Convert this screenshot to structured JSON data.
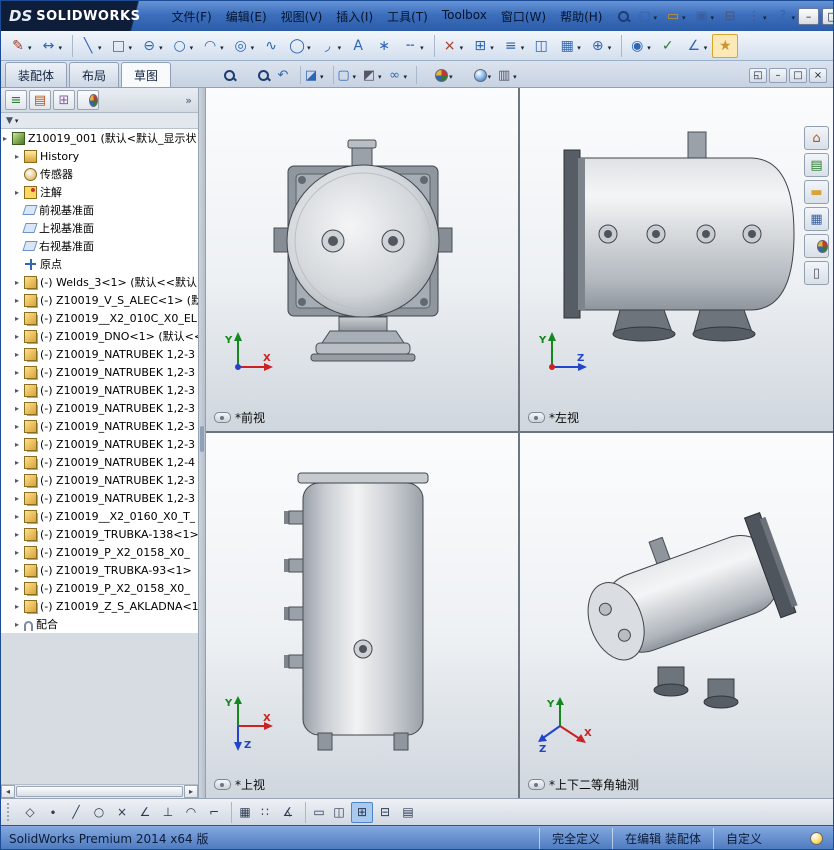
{
  "window": {
    "logo_prefix": "DS",
    "logo_text": "SOLIDWORKS",
    "min": "–",
    "max": "□",
    "close": "×"
  },
  "menu": {
    "items": [
      "文件(F)",
      "编辑(E)",
      "视图(V)",
      "插入(I)",
      "工具(T)",
      "Toolbox",
      "窗口(W)",
      "帮助(H)"
    ]
  },
  "quickbar": {
    "icons": [
      {
        "name": "new-document-button",
        "glyph": "▢",
        "color": "#3a5f9e",
        "dd": "dd"
      },
      {
        "name": "open-button",
        "glyph": "▭",
        "color": "#c9952c",
        "dd": "dd"
      },
      {
        "name": "save-button",
        "glyph": "▣",
        "color": "#3a5f9e",
        "dd": "dd"
      },
      {
        "name": "print-button",
        "glyph": "⊟",
        "color": "#556",
        "dd": ""
      },
      {
        "name": "options-button",
        "glyph": "⋮",
        "color": "#556",
        "dd": "dd"
      },
      {
        "name": "help-button",
        "glyph": "?",
        "color": "#2f66b3",
        "dd": "dd"
      }
    ]
  },
  "sketchbar": {
    "icons": [
      {
        "name": "sketch-tool-button",
        "glyph": "✎",
        "color": "#a33a2a",
        "dd": "dd",
        "cls": ""
      },
      {
        "name": "smart-dimension-button",
        "glyph": "↔",
        "color": "#2f66b3",
        "dd": "dd",
        "cls": ""
      },
      {
        "name": "line-tool-button",
        "glyph": "╲",
        "color": "#2f66b3",
        "dd": "dd",
        "cls": "sep"
      },
      {
        "name": "rectangle-tool-button",
        "glyph": "□",
        "color": "#2f66b3",
        "dd": "dd",
        "cls": ""
      },
      {
        "name": "slot-tool-button",
        "glyph": "⊖",
        "color": "#2f66b3",
        "dd": "dd",
        "cls": ""
      },
      {
        "name": "circle-tool-button",
        "glyph": "○",
        "color": "#2f66b3",
        "dd": "dd",
        "cls": ""
      },
      {
        "name": "arc-tool-button",
        "glyph": "◠",
        "color": "#2f66b3",
        "dd": "dd",
        "cls": ""
      },
      {
        "name": "perimeter-circle-button",
        "glyph": "◎",
        "color": "#2f66b3",
        "dd": "dd",
        "cls": ""
      },
      {
        "name": "spline-tool-button",
        "glyph": "∿",
        "color": "#2f66b3",
        "dd": "",
        "cls": ""
      },
      {
        "name": "ellipse-tool-button",
        "glyph": "◯",
        "color": "#2f66b3",
        "dd": "dd",
        "cls": ""
      },
      {
        "name": "fillet-tool-button",
        "glyph": "◞",
        "color": "#2f66b3",
        "dd": "dd",
        "cls": ""
      },
      {
        "name": "text-tool-button",
        "glyph": "A",
        "color": "#2f66b3",
        "dd": "",
        "cls": ""
      },
      {
        "name": "point-tool-button",
        "glyph": "∗",
        "color": "#2f66b3",
        "dd": "",
        "cls": ""
      },
      {
        "name": "centerline-tool-button",
        "glyph": "╌",
        "color": "#2f66b3",
        "dd": "dd",
        "cls": ""
      },
      {
        "name": "trim-entities-button",
        "glyph": "×",
        "color": "#a33a2a",
        "dd": "dd",
        "cls": "sep"
      },
      {
        "name": "convert-entities-button",
        "glyph": "⊞",
        "color": "#2f66b3",
        "dd": "dd",
        "cls": ""
      },
      {
        "name": "offset-entities-button",
        "glyph": "≡",
        "color": "#2f66b3",
        "dd": "dd",
        "cls": ""
      },
      {
        "name": "mirror-entities-button",
        "glyph": "◫",
        "color": "#2f66b3",
        "dd": "",
        "cls": ""
      },
      {
        "name": "linear-pattern-button",
        "glyph": "▦",
        "color": "#2f66b3",
        "dd": "dd",
        "cls": ""
      },
      {
        "name": "move-entities-button",
        "glyph": "⊕",
        "color": "#2f66b3",
        "dd": "dd",
        "cls": ""
      },
      {
        "name": "display-relations-button",
        "glyph": "◉",
        "color": "#2f66b3",
        "dd": "dd",
        "cls": "sep"
      },
      {
        "name": "repair-sketch-button",
        "glyph": "✓",
        "color": "#2e7d32",
        "dd": "",
        "cls": ""
      },
      {
        "name": "quick-snaps-button",
        "glyph": "∠",
        "color": "#2f66b3",
        "dd": "dd",
        "cls": ""
      },
      {
        "name": "rapid-sketch-button",
        "glyph": "★",
        "color": "#c9952c",
        "dd": "",
        "cls": "hot"
      }
    ]
  },
  "tabs": {
    "items": [
      {
        "label": "装配体",
        "cls": ""
      },
      {
        "label": "布局",
        "cls": ""
      },
      {
        "label": "草图",
        "cls": "active"
      }
    ]
  },
  "hud": {
    "icons": [
      {
        "name": "zoom-fit-button",
        "glyph": "",
        "color": "",
        "icon_cls": "i-mag",
        "dd": "",
        "cls": ""
      },
      {
        "name": "zoom-area-button",
        "glyph": "",
        "color": "",
        "icon_cls": "i-mag",
        "dd": "",
        "cls": ""
      },
      {
        "name": "previous-view-button",
        "glyph": "↶",
        "color": "#2f66b3",
        "icon_cls": "",
        "dd": "",
        "cls": ""
      },
      {
        "name": "section-view-button",
        "glyph": "◪",
        "color": "#2f66b3",
        "icon_cls": "",
        "dd": "dd",
        "cls": "sep"
      },
      {
        "name": "view-orientation-button",
        "glyph": "▢",
        "color": "#2f66b3",
        "icon_cls": "",
        "dd": "dd",
        "cls": "sep"
      },
      {
        "name": "display-style-button",
        "glyph": "◩",
        "color": "#556",
        "icon_cls": "",
        "dd": "dd",
        "cls": ""
      },
      {
        "name": "hide-show-items-button",
        "glyph": "∞",
        "color": "#2f66b3",
        "icon_cls": "",
        "dd": "dd",
        "cls": ""
      },
      {
        "name": "edit-appearance-button",
        "glyph": "",
        "color": "",
        "icon_cls": "i-ball i-ball-m",
        "dd": "dd",
        "cls": "sep"
      },
      {
        "name": "apply-scene-button",
        "glyph": "",
        "color": "",
        "icon_cls": "i-ball",
        "dd": "dd",
        "cls": ""
      },
      {
        "name": "view-settings-button",
        "glyph": "▥",
        "color": "#556",
        "icon_cls": "",
        "dd": "dd",
        "cls": ""
      }
    ]
  },
  "docwin": {
    "buttons": [
      {
        "name": "doc-new-window-button",
        "glyph": "◱"
      },
      {
        "name": "doc-minimize-button",
        "glyph": "–"
      },
      {
        "name": "doc-restore-button",
        "glyph": "□"
      },
      {
        "name": "doc-close-button",
        "glyph": "×"
      }
    ]
  },
  "panel": {
    "tabs": [
      {
        "name": "featuremanager-tab",
        "glyph": "≡",
        "color": "#2e7d32",
        "icon_cls": ""
      },
      {
        "name": "propertymanager-tab",
        "glyph": "▤",
        "color": "#b5541c",
        "icon_cls": ""
      },
      {
        "name": "configurationmanager-tab",
        "glyph": "⊞",
        "color": "#8a5fa8",
        "icon_cls": ""
      },
      {
        "name": "displaymanager-tab",
        "glyph": "",
        "color": "",
        "icon_cls": "i-ball i-ball-m"
      }
    ],
    "overflow_glyph": "»",
    "filter_glyph": "▼",
    "tree": [
      {
        "row_cls": "root",
        "exp": "exp",
        "ic": "ti-asm",
        "label": "Z10019_001 (默认<默认_显示状"
      },
      {
        "row_cls": "",
        "exp": "exp",
        "ic": "ti-hist",
        "label": "History"
      },
      {
        "row_cls": "",
        "exp": "",
        "ic": "ti-sens",
        "label": "传感器"
      },
      {
        "row_cls": "",
        "exp": "exp",
        "ic": "ti-ann",
        "label": "注解"
      },
      {
        "row_cls": "",
        "exp": "",
        "ic": "ti-plane",
        "label": "前视基准面"
      },
      {
        "row_cls": "",
        "exp": "",
        "ic": "ti-plane",
        "label": "上视基准面"
      },
      {
        "row_cls": "",
        "exp": "",
        "ic": "ti-plane",
        "label": "右视基准面"
      },
      {
        "row_cls": "",
        "exp": "",
        "ic": "ti-orig",
        "label": "原点"
      },
      {
        "row_cls": "",
        "exp": "exp",
        "ic": "ti-part",
        "label": "(-) Welds_3<1> (默认<<默认"
      },
      {
        "row_cls": "",
        "exp": "exp",
        "ic": "ti-part",
        "label": "(-) Z10019_V_S_ALEC<1> (默"
      },
      {
        "row_cls": "",
        "exp": "exp",
        "ic": "ti-part",
        "label": "(-) Z10019__X2_010C_X0_EL"
      },
      {
        "row_cls": "",
        "exp": "exp",
        "ic": "ti-part",
        "label": "(-) Z10019_DNO<1> (默认<<"
      },
      {
        "row_cls": "",
        "exp": "exp",
        "ic": "ti-part",
        "label": "(-) Z10019_NATRUBEK 1,2-3"
      },
      {
        "row_cls": "",
        "exp": "exp",
        "ic": "ti-part",
        "label": "(-) Z10019_NATRUBEK 1,2-3"
      },
      {
        "row_cls": "",
        "exp": "exp",
        "ic": "ti-part",
        "label": "(-) Z10019_NATRUBEK 1,2-3"
      },
      {
        "row_cls": "",
        "exp": "exp",
        "ic": "ti-part",
        "label": "(-) Z10019_NATRUBEK 1,2-3"
      },
      {
        "row_cls": "",
        "exp": "exp",
        "ic": "ti-part",
        "label": "(-) Z10019_NATRUBEK 1,2-3"
      },
      {
        "row_cls": "",
        "exp": "exp",
        "ic": "ti-part",
        "label": "(-) Z10019_NATRUBEK 1,2-3"
      },
      {
        "row_cls": "",
        "exp": "exp",
        "ic": "ti-part",
        "label": "(-) Z10019_NATRUBEK 1,2-4"
      },
      {
        "row_cls": "",
        "exp": "exp",
        "ic": "ti-part",
        "label": "(-) Z10019_NATRUBEK 1,2-3"
      },
      {
        "row_cls": "",
        "exp": "exp",
        "ic": "ti-part",
        "label": "(-) Z10019_NATRUBEK 1,2-3"
      },
      {
        "row_cls": "",
        "exp": "exp",
        "ic": "ti-part",
        "label": "(-) Z10019__X2_0160_X0_T_"
      },
      {
        "row_cls": "",
        "exp": "exp",
        "ic": "ti-part",
        "label": "(-) Z10019_TRUBKA-138<1>"
      },
      {
        "row_cls": "",
        "exp": "exp",
        "ic": "ti-part",
        "label": "(-) Z10019_P_X2_0158_X0_"
      },
      {
        "row_cls": "",
        "exp": "exp",
        "ic": "ti-part",
        "label": "(-) Z10019_TRUBKA-93<1>"
      },
      {
        "row_cls": "",
        "exp": "exp",
        "ic": "ti-part",
        "label": "(-) Z10019_P_X2_0158_X0_"
      },
      {
        "row_cls": "",
        "exp": "exp",
        "ic": "ti-part",
        "label": "(-) Z10019_Z_S_AKLADNA<1>"
      },
      {
        "row_cls": "",
        "exp": "exp",
        "ic": "ti-mate",
        "label": "配合"
      }
    ]
  },
  "views": {
    "front": {
      "label": "*前视",
      "axis_v": "Y",
      "axis_h": "X"
    },
    "left": {
      "label": "*左视",
      "axis_v": "Y",
      "axis_h": "Z"
    },
    "top": {
      "label": "*上视",
      "axis_v": "Y",
      "axis_h": "X",
      "axis_d": "Z"
    },
    "iso": {
      "label": "*上下二等角轴测",
      "axis_v": "Y",
      "axis_h": "X",
      "axis_d": "Z"
    }
  },
  "taskpane": {
    "tabs": [
      {
        "name": "resources-tab",
        "glyph": "⌂",
        "color": "#b5541c",
        "icon_cls": ""
      },
      {
        "name": "design-library-tab",
        "glyph": "▤",
        "color": "#2e7d32",
        "icon_cls": ""
      },
      {
        "name": "file-explorer-tab",
        "glyph": "▬",
        "color": "#d7a33a",
        "icon_cls": ""
      },
      {
        "name": "view-palette-tab",
        "glyph": "▦",
        "color": "#3a5f9e",
        "icon_cls": ""
      },
      {
        "name": "appearances-tab",
        "glyph": "",
        "color": "",
        "icon_cls": "i-ball i-ball-m"
      },
      {
        "name": "custom-properties-tab",
        "glyph": "▯",
        "color": "#556",
        "icon_cls": ""
      }
    ]
  },
  "bottombar": {
    "icons": [
      {
        "name": "selection-filter-toggle",
        "glyph": "◇",
        "cls": ""
      },
      {
        "name": "filter-vertices-button",
        "glyph": "∙",
        "cls": ""
      },
      {
        "name": "filter-edges-button",
        "glyph": "╱",
        "cls": ""
      },
      {
        "name": "filter-faces-button",
        "glyph": "○",
        "cls": ""
      },
      {
        "name": "filter-intersections-button",
        "glyph": "×",
        "cls": ""
      },
      {
        "name": "filter-angle-button",
        "glyph": "∠",
        "cls": ""
      },
      {
        "name": "filter-perpendicular-button",
        "glyph": "⊥",
        "cls": ""
      },
      {
        "name": "filter-tangent-button",
        "glyph": "◠",
        "cls": ""
      },
      {
        "name": "filter-corner-button",
        "glyph": "⌐",
        "cls": ""
      },
      {
        "name": "grid-snap-button",
        "glyph": "▦",
        "cls": "sep"
      },
      {
        "name": "snap-points-button",
        "glyph": "∷",
        "cls": ""
      },
      {
        "name": "snap-angle-button",
        "glyph": "∡",
        "cls": ""
      },
      {
        "name": "viewport-single-button",
        "glyph": "▭",
        "cls": "sep"
      },
      {
        "name": "viewport-two-button",
        "glyph": "◫",
        "cls": ""
      },
      {
        "name": "viewport-four-button",
        "glyph": "⊞",
        "cls": "active"
      },
      {
        "name": "viewport-horizontal-button",
        "glyph": "⊟",
        "cls": ""
      },
      {
        "name": "link-views-button",
        "glyph": "▤",
        "cls": ""
      }
    ]
  },
  "statusbar": {
    "left": "SolidWorks Premium 2014 x64 版",
    "define_state": "完全定义",
    "edit_state": "在编辑 装配体",
    "custom": "自定义"
  }
}
